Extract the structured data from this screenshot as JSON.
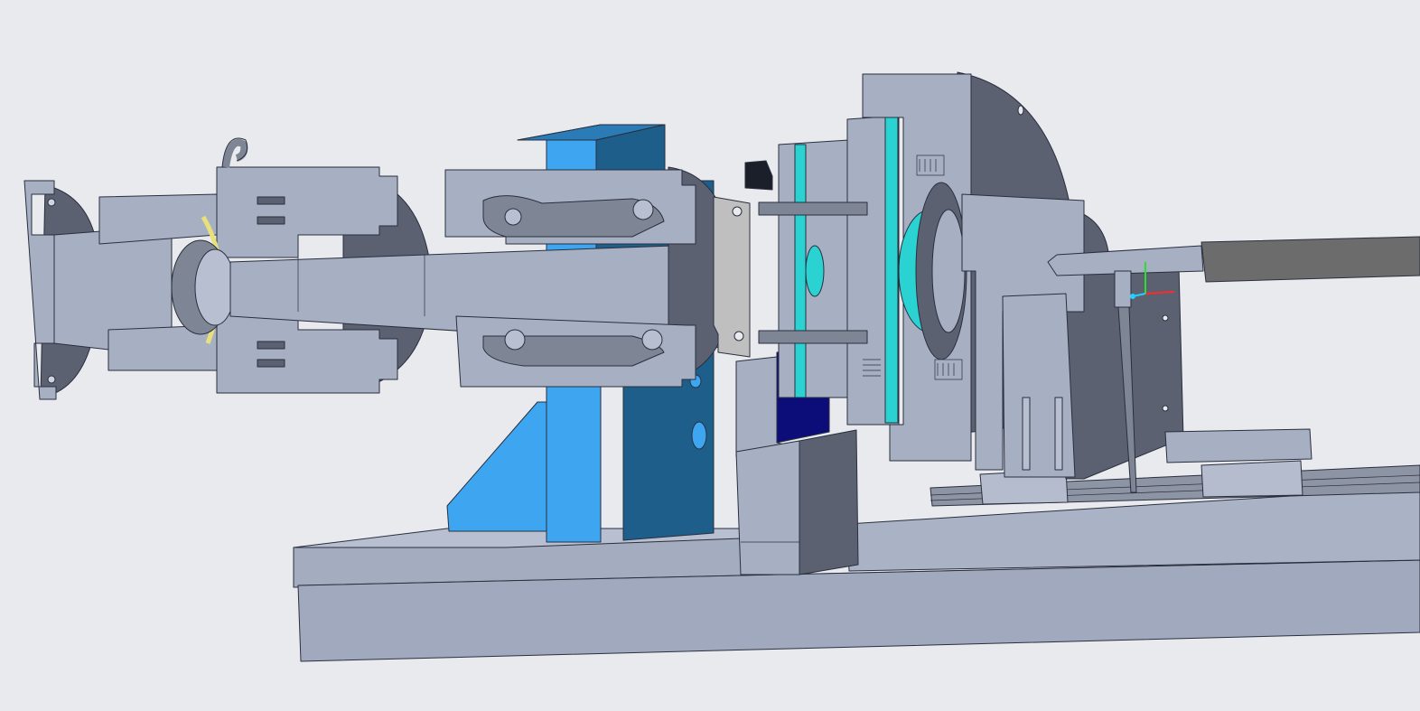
{
  "scene": {
    "background": "#e8eaee",
    "palette": {
      "steel_face": "#a7b0c3",
      "steel_light": "#b7bfd0",
      "steel_dark": "#5b6170",
      "steel_mid": "#7e8595",
      "bracket_light": "#3ea6f0",
      "bracket_dark": "#1d5f8a",
      "block_navy": "#0d0d7a",
      "accent_cyan": "#2ad2d2",
      "gasket_yellow": "#e8e07a",
      "rod_gray": "#6c6c6c",
      "edge": "#2a2f3e"
    },
    "triad": {
      "x_color": "#ff2a2a",
      "y_color": "#2ae02a",
      "z_color": "#22d0ff"
    }
  }
}
